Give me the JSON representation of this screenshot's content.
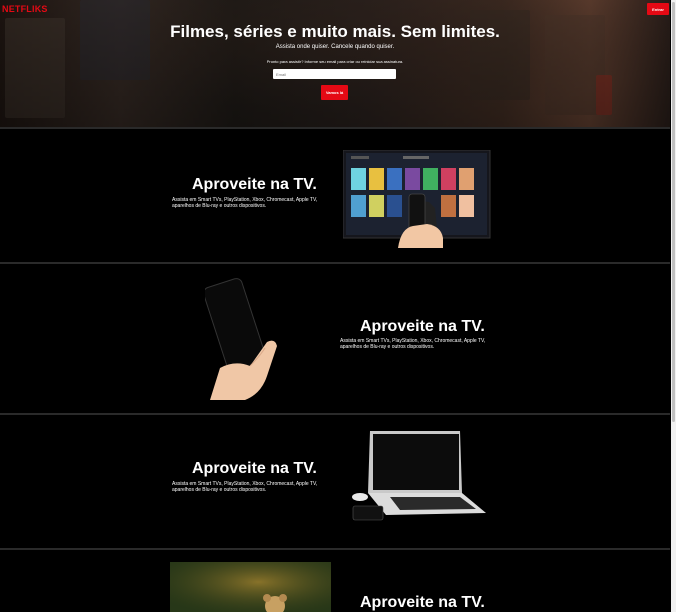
{
  "header": {
    "logo": "NETFLIKS",
    "signin_label": "Entrar"
  },
  "hero": {
    "title": "Filmes, séries e muito mais. Sem limites.",
    "subtitle": "Assista onde quiser. Cancele quando quiser.",
    "prompt": "Pronto para assistir? Informe seu email para criar ou reiniciar sua assinatura.",
    "email_placeholder": "Email",
    "start_label": "Vamos lá"
  },
  "features": [
    {
      "title": "Aproveite na TV.",
      "description": "Assista em Smart TVs, PlayStation, Xbox, Chromecast, Apple TV, aparelhos de Blu-ray e outros dispositivos."
    },
    {
      "title": "Aproveite na TV.",
      "description": "Assista em Smart TVs, PlayStation, Xbox, Chromecast, Apple TV, aparelhos de Blu-ray e outros dispositivos."
    },
    {
      "title": "Aproveite na TV.",
      "description": "Assista em Smart TVs, PlayStation, Xbox, Chromecast, Apple TV, aparelhos de Blu-ray e outros dispositivos."
    },
    {
      "title": "Aproveite na TV."
    }
  ],
  "colors": {
    "brand_red": "#e50914",
    "background": "#000000",
    "divider": "#2a2a2a"
  }
}
